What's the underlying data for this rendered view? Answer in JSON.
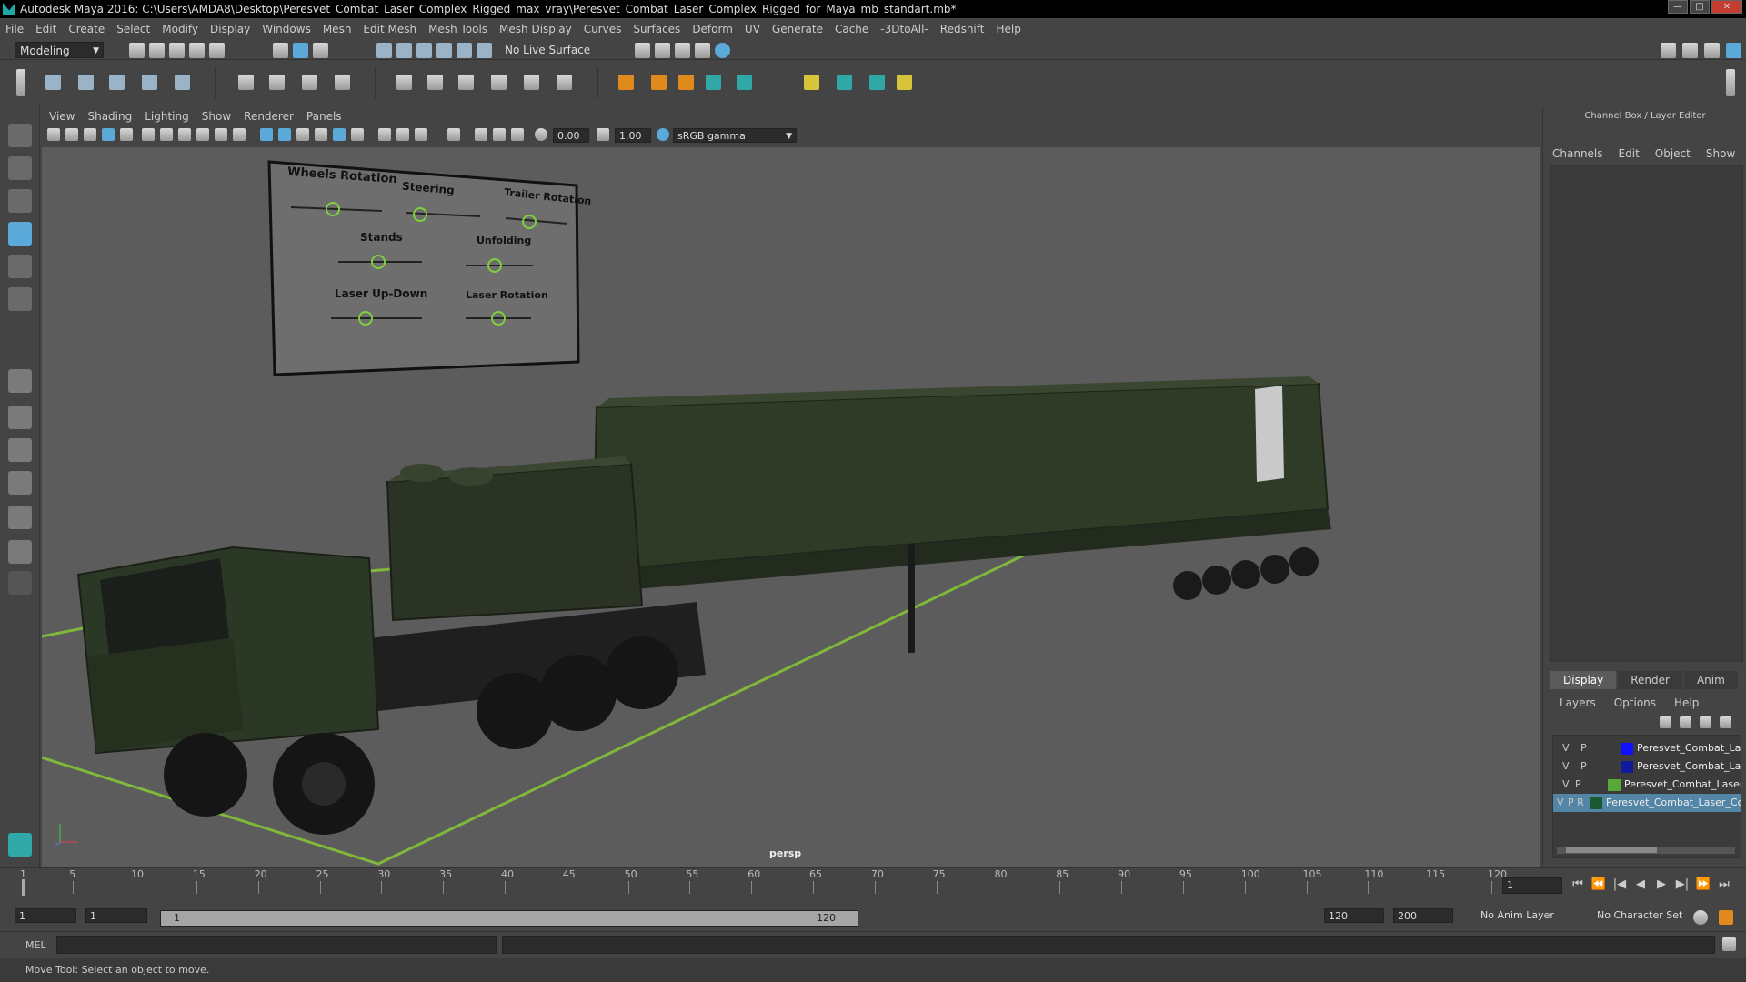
{
  "window": {
    "title": "Autodesk Maya 2016: C:\\Users\\AMDA8\\Desktop\\Peresvet_Combat_Laser_Complex_Rigged_max_vray\\Peresvet_Combat_Laser_Complex_Rigged_for_Maya_mb_standart.mb*",
    "minimize": "—",
    "maximize": "□",
    "close": "✕"
  },
  "menubar": [
    "File",
    "Edit",
    "Create",
    "Select",
    "Modify",
    "Display",
    "Windows",
    "Mesh",
    "Edit Mesh",
    "Mesh Tools",
    "Mesh Display",
    "Curves",
    "Surfaces",
    "Deform",
    "UV",
    "Generate",
    "Cache",
    "-3DtoAll-",
    "Redshift",
    "Help"
  ],
  "statusline": {
    "menu_set": "Modeling",
    "live_surface": "No Live Surface"
  },
  "panel": {
    "menus": [
      "View",
      "Shading",
      "Lighting",
      "Show",
      "Renderer",
      "Panels"
    ],
    "exposure": "0.00",
    "gamma": "1.00",
    "color_space": "sRGB gamma",
    "camera": "persp"
  },
  "rig_board": {
    "labels": [
      "Wheels Rotation",
      "Steering",
      "Trailer Rotation",
      "Stands",
      "Unfolding",
      "Laser Up-Down",
      "Laser Rotation"
    ]
  },
  "channel_box": {
    "title": "Channel Box / Layer Editor",
    "menus": [
      "Channels",
      "Edit",
      "Object",
      "Show"
    ]
  },
  "layer_editor": {
    "tabs": [
      "Display",
      "Render",
      "Anim"
    ],
    "active_tab": "Display",
    "menus": [
      "Layers",
      "Options",
      "Help"
    ],
    "layers": [
      {
        "v": "V",
        "p": "P",
        "name": "Peresvet_Combat_Lase",
        "color": "#1010ff",
        "selected": false
      },
      {
        "v": "V",
        "p": "P",
        "name": "Peresvet_Combat_Lase",
        "color": "#101a9a",
        "selected": false
      },
      {
        "v": "V",
        "p": "P",
        "name": "Peresvet_Combat_Laser_(",
        "color": "#5aa83a",
        "selected": false
      },
      {
        "v": "V",
        "p": "P R",
        "name": "Peresvet_Combat_Laser_Com",
        "color": "#1b5a30",
        "selected": true
      }
    ]
  },
  "timeline": {
    "ticks": [
      "1",
      "5",
      "10",
      "15",
      "20",
      "25",
      "30",
      "35",
      "40",
      "45",
      "50",
      "55",
      "60",
      "65",
      "70",
      "75",
      "80",
      "85",
      "90",
      "95",
      "100",
      "105",
      "110",
      "115",
      "120"
    ],
    "current_frame": "1",
    "play_controls": [
      "⏮",
      "⏪",
      "|◀",
      "◀",
      "▶",
      "▶|",
      "⏩",
      "⏭"
    ]
  },
  "range": {
    "start": "1",
    "playback_start": "1",
    "slider_start": "1",
    "slider_end": "120",
    "playback_end": "120",
    "end": "200",
    "anim_layer": "No Anim Layer",
    "character_set": "No Character Set"
  },
  "command": {
    "mode": "MEL"
  },
  "help": {
    "text": "Move Tool: Select an object to move."
  },
  "colors": {
    "grid_line": "#7fb83a",
    "truck_green": "#2f3a27",
    "selected_layer": "#5285a6"
  }
}
